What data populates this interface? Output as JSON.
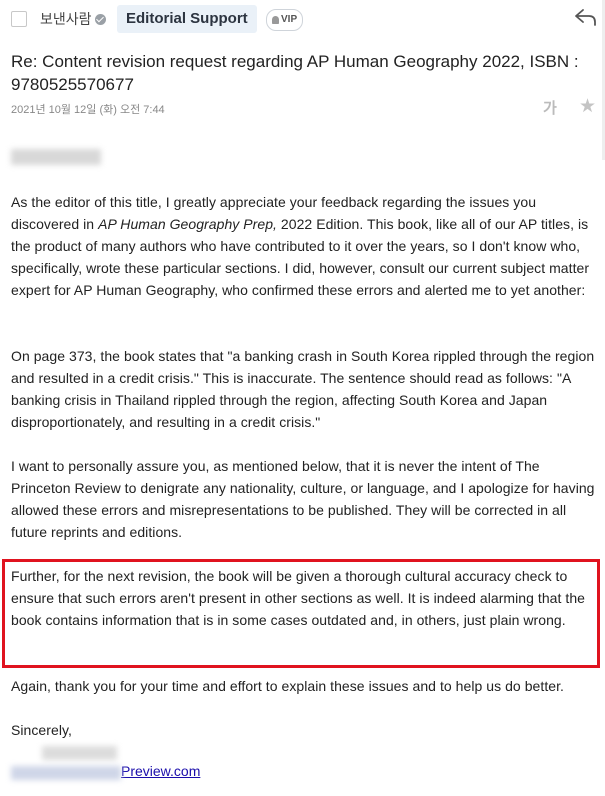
{
  "header": {
    "sender_label": "보낸사람",
    "sender_name": "Editorial Support",
    "vip_badge": "VIP"
  },
  "email": {
    "subject": "Re: Content revision request regarding AP Human Geography 2022, ISBN : 9780525570677",
    "date": "2021년 10월 12일 (화) 오전 7:44",
    "font_size_icon": "가",
    "paragraphs": {
      "p1_a": "As the editor of this title, I greatly appreciate your feedback regarding the issues you discovered in ",
      "p1_title": "AP Human Geography Prep,",
      "p1_b": " 2022 Edition. This book, like all of our AP titles, is the product of many authors who have contributed to it over the years, so I don't know who, specifically, wrote these particular sections. I did, however, consult our current subject matter expert for AP Human Geography, who confirmed these errors and alerted me to yet another:",
      "p2": "On page 373, the book states that \"a banking crash in South Korea rippled through the region and resulted in a credit crisis.\" This is inaccurate. The sentence should read as follows: \"A banking crisis in Thailand rippled through the region, affecting South Korea and Japan disproportionately, and resulting in a credit crisis.\"",
      "p3": "I want to personally assure you, as mentioned below, that it is never the intent of The Princeton Review to denigrate any nationality, culture, or language, and I apologize for having allowed these errors and misrepresentations to be published. They will be corrected in all future reprints and editions.",
      "p4": "Further, for the next revision, the book will be given a thorough cultural accuracy check to ensure that such errors aren't present in other sections as well. It is indeed alarming that the book contains information that is in some cases outdated and, in others, just plain wrong.",
      "p5": "Again, thank you for your time and effort to explain these issues and to help us do better.",
      "p6": "Sincerely,"
    },
    "signature_email_suffix": "Preview.com"
  },
  "colors": {
    "highlight_border": "#e0131f",
    "link": "#1a0dab",
    "chip_bg": "#eaf1f8"
  }
}
